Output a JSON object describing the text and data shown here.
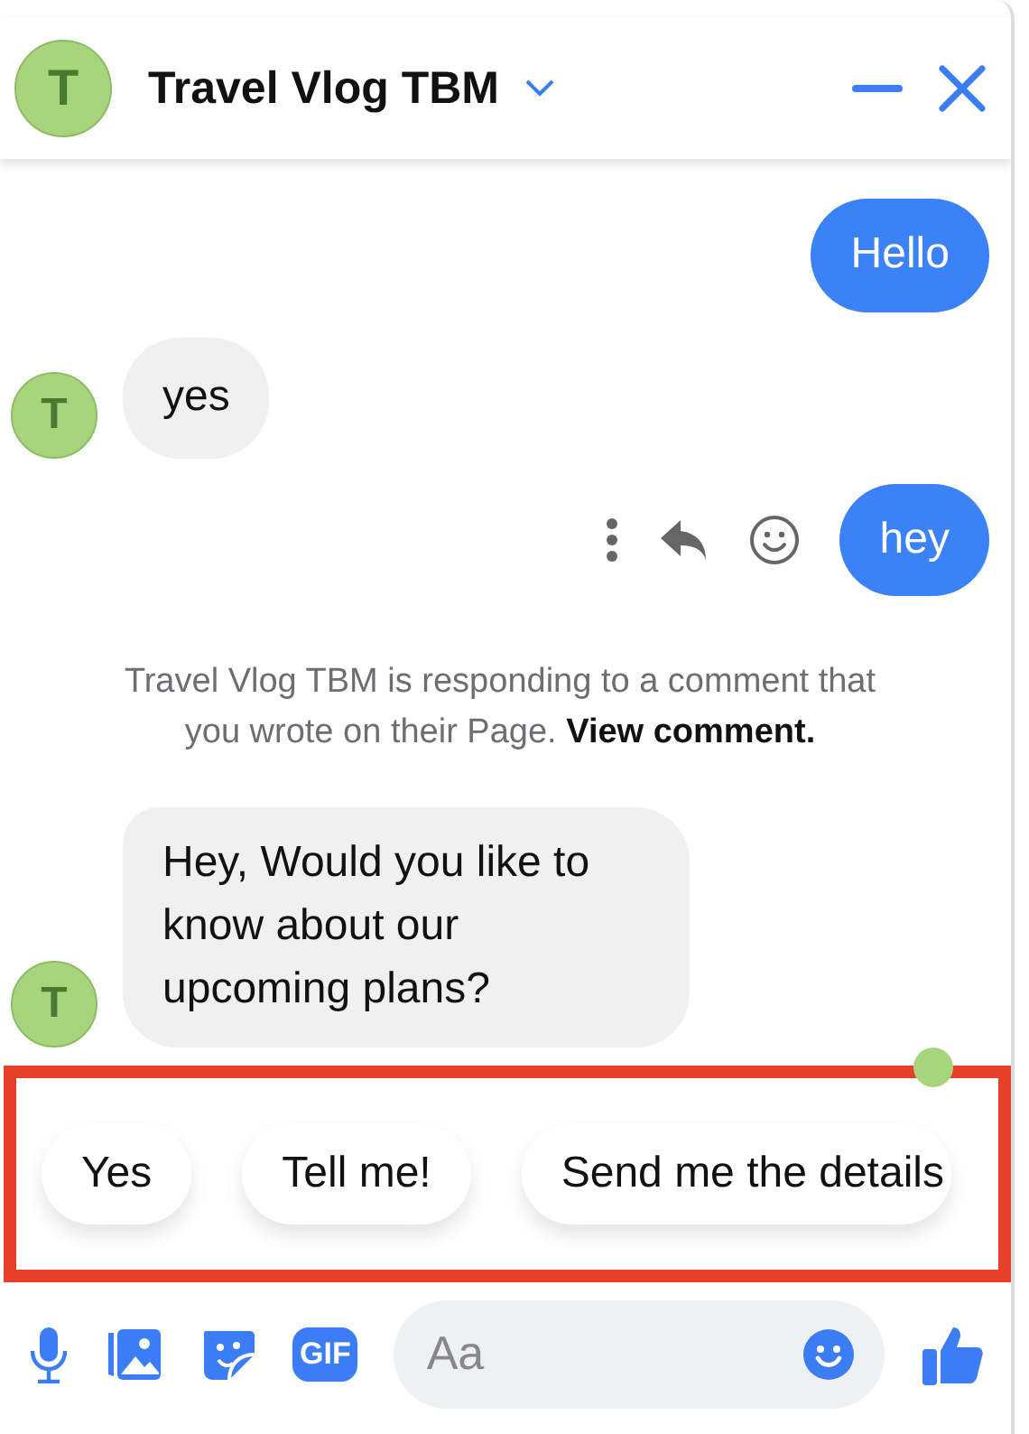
{
  "header": {
    "avatar_letter": "T",
    "title": "Travel Vlog TBM"
  },
  "messages": [
    {
      "kind": "outgoing",
      "text": "Hello",
      "hovered": false
    },
    {
      "kind": "incoming",
      "avatar_letter": "T",
      "text": "yes"
    },
    {
      "kind": "outgoing",
      "text": "hey",
      "hovered": true
    },
    {
      "kind": "notice",
      "text": "Travel Vlog TBM is responding to a comment that you wrote on their Page.",
      "link": "View comment."
    },
    {
      "kind": "incoming",
      "avatar_letter": "T",
      "text": "Hey, Would you like to know about our upcoming plans?"
    }
  ],
  "seen": true,
  "quick_replies": {
    "highlighted": true,
    "items": [
      "Yes",
      "Tell me!",
      "Send me the details"
    ]
  },
  "composer": {
    "gif_label": "GIF",
    "placeholder": "Aa"
  }
}
